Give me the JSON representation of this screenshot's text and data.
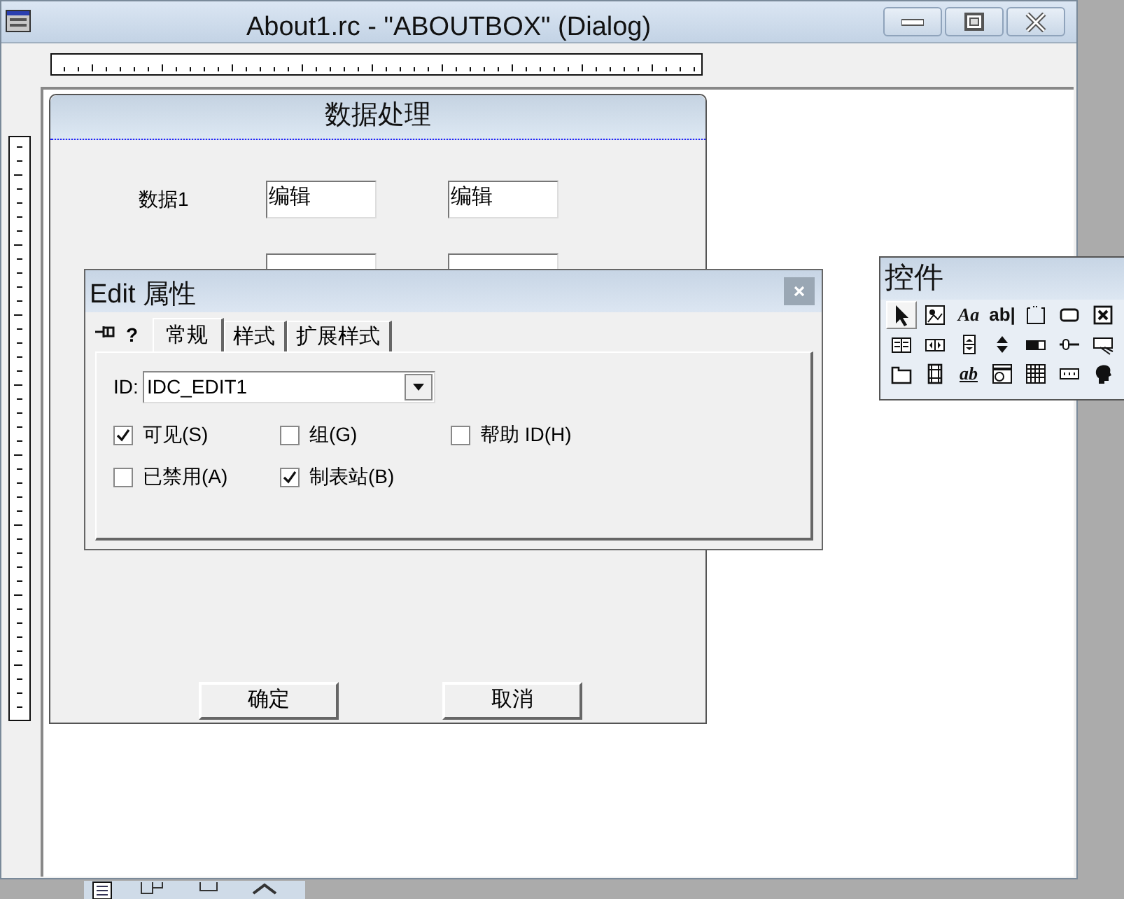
{
  "window": {
    "title": "About1.rc - \"ABOUTBOX\" (Dialog)"
  },
  "dialog": {
    "title": "数据处理",
    "rows": [
      {
        "label": "数据1",
        "fields": [
          {
            "value": "编辑"
          },
          {
            "value": "编辑"
          }
        ]
      },
      {
        "fields": [
          {
            "kind": "edit"
          },
          {
            "kind": "edit"
          }
        ]
      }
    ],
    "buttons": [
      "确定",
      "取消"
    ]
  },
  "properties": {
    "title": "Edit 属性",
    "help_glyph": "?",
    "tabs": [
      {
        "label": "常规",
        "selected": true
      },
      {
        "label": "样式",
        "selected": false
      },
      {
        "label": "扩展样式",
        "selected": false
      }
    ],
    "id_label": "ID:",
    "id_value": "IDC_EDIT1",
    "checkboxes": [
      {
        "label": "可见(S)",
        "checked": true
      },
      {
        "label": "组(G)",
        "checked": false
      },
      {
        "label": "帮助 ID(H)",
        "checked": false
      },
      {
        "label": "已禁用(A)",
        "checked": false
      },
      {
        "label": "制表站(B)",
        "checked": true
      }
    ]
  },
  "toolbox": {
    "title": "控件",
    "items": [
      {
        "selected": true
      },
      {
        "selected": false
      },
      {
        "selected": false,
        "glyph": "Aa"
      },
      {
        "selected": false,
        "glyph": "ab|"
      },
      {
        "selected": false
      },
      {
        "selected": false
      },
      {
        "selected": false
      },
      {
        "selected": false
      },
      {
        "selected": false
      },
      {
        "selected": false
      },
      {
        "selected": false
      },
      {
        "selected": false
      },
      {
        "selected": false
      },
      {
        "selected": false
      },
      {
        "selected": false
      },
      {
        "selected": false
      },
      {
        "selected": false,
        "glyph": "ab"
      },
      {
        "selected": false
      },
      {
        "selected": false
      },
      {
        "selected": false
      },
      {
        "selected": false
      }
    ]
  }
}
